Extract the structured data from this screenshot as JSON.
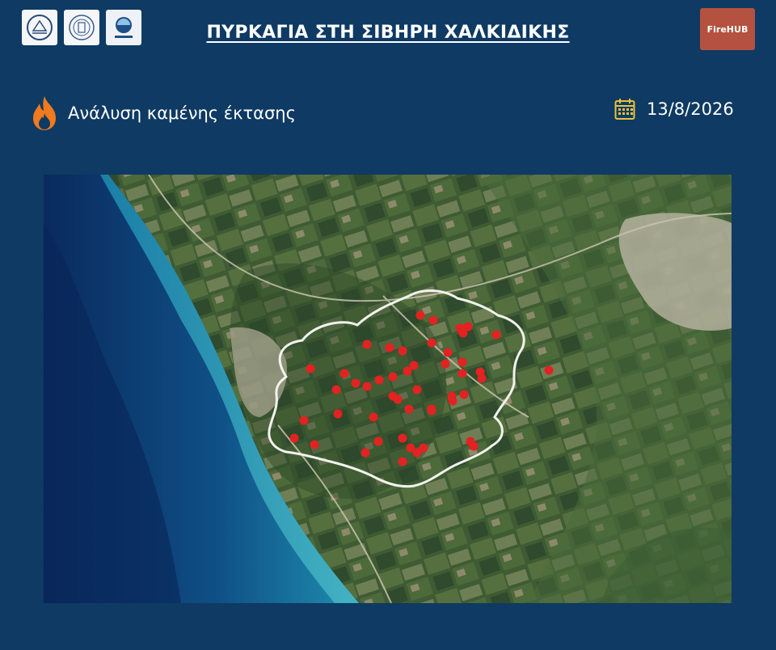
{
  "header": {
    "title": "ΠΥΡΚΑΓΙΑ  ΣΤΗ ΣΙΒΗΡΗ ΧΑΛΚΙΔΙΚΗΣ",
    "logos": [
      "university-seal-icon",
      "institute-seal-icon",
      "observatory-logo-icon"
    ],
    "brand_label": "FireHUB"
  },
  "section": {
    "icon": "flame-icon",
    "label": "Ανάλυση καμένης έκτασης"
  },
  "date": {
    "icon": "calendar-icon",
    "value": "13/8/2026"
  },
  "map": {
    "type": "satellite",
    "burn_perimeter_color": "#f2f2ee",
    "hotspot_color": "#e32222",
    "hotspot_count": 49
  }
}
